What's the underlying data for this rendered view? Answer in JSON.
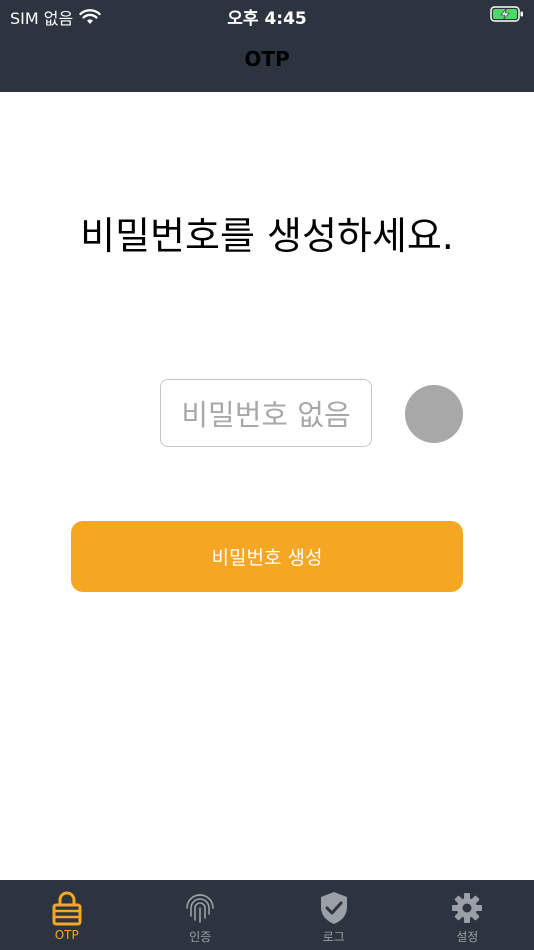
{
  "status_bar": {
    "carrier": "SIM 없음",
    "time": "오후 4:45"
  },
  "nav": {
    "title": "OTP"
  },
  "main": {
    "prompt": "비밀번호를 생성하세요.",
    "password_placeholder": "비밀번호 없음",
    "generate_label": "비밀번호 생성"
  },
  "tabs": [
    {
      "label": "OTP",
      "icon": "lock-icon",
      "active": true
    },
    {
      "label": "인증",
      "icon": "fingerprint-icon",
      "active": false
    },
    {
      "label": "로그",
      "icon": "shield-check-icon",
      "active": false
    },
    {
      "label": "설정",
      "icon": "gear-icon",
      "active": false
    }
  ],
  "colors": {
    "header_bg": "#2c3440",
    "accent": "#f5a623",
    "inactive_icon": "#9aa0a6",
    "timer_gray": "#a8a8a8"
  }
}
